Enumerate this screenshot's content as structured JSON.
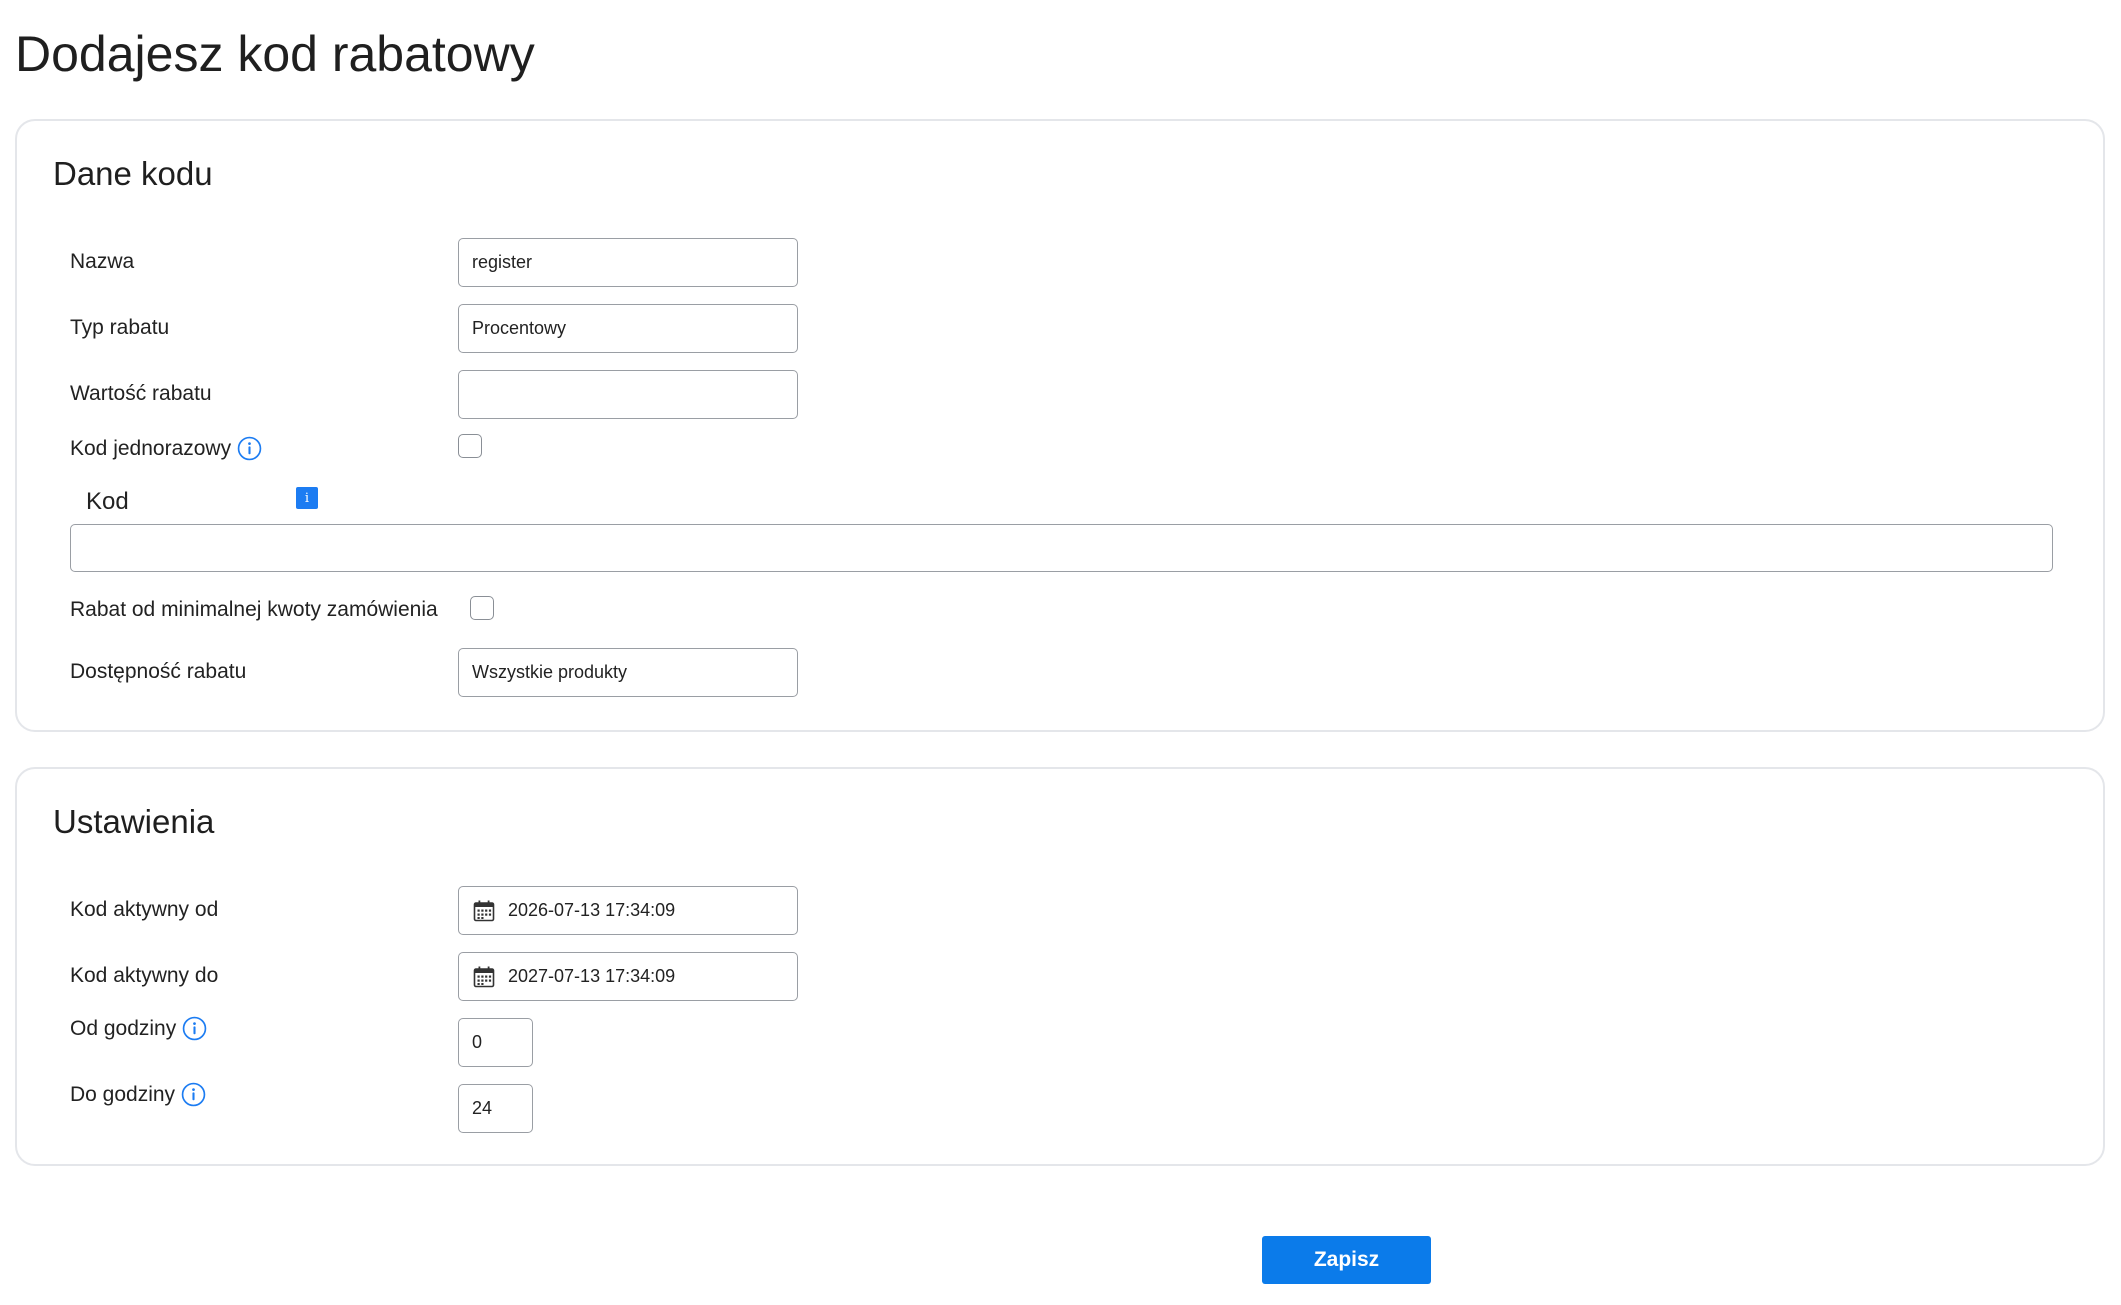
{
  "page": {
    "title": "Dodajesz kod rabatowy"
  },
  "code_data": {
    "title": "Dane kodu",
    "name": {
      "label": "Nazwa",
      "value": "register"
    },
    "discount_type": {
      "label": "Typ rabatu",
      "value": "Procentowy"
    },
    "discount_value": {
      "label": "Wartość rabatu",
      "value": ""
    },
    "one_time_code": {
      "label": "Kod jednorazowy",
      "checked": false
    },
    "code": {
      "label": "Kod",
      "info": "i",
      "value": ""
    },
    "min_order_discount": {
      "label": "Rabat od minimalnej kwoty zamówienia",
      "checked": false
    },
    "availability": {
      "label": "Dostępność rabatu",
      "value": "Wszystkie produkty"
    }
  },
  "settings": {
    "title": "Ustawienia",
    "active_from": {
      "label": "Kod aktywny od",
      "value": "2026-07-13 17:34:09"
    },
    "active_to": {
      "label": "Kod aktywny do",
      "value": "2027-07-13 17:34:09"
    },
    "from_hour": {
      "label": "Od godziny",
      "value": "0"
    },
    "to_hour": {
      "label": "Do godziny",
      "value": "24"
    }
  },
  "actions": {
    "save_label": "Zapisz"
  },
  "colors": {
    "accent": "#0b7bea",
    "info_icon": "#1c7cf2",
    "border": "#9a9ea4"
  }
}
